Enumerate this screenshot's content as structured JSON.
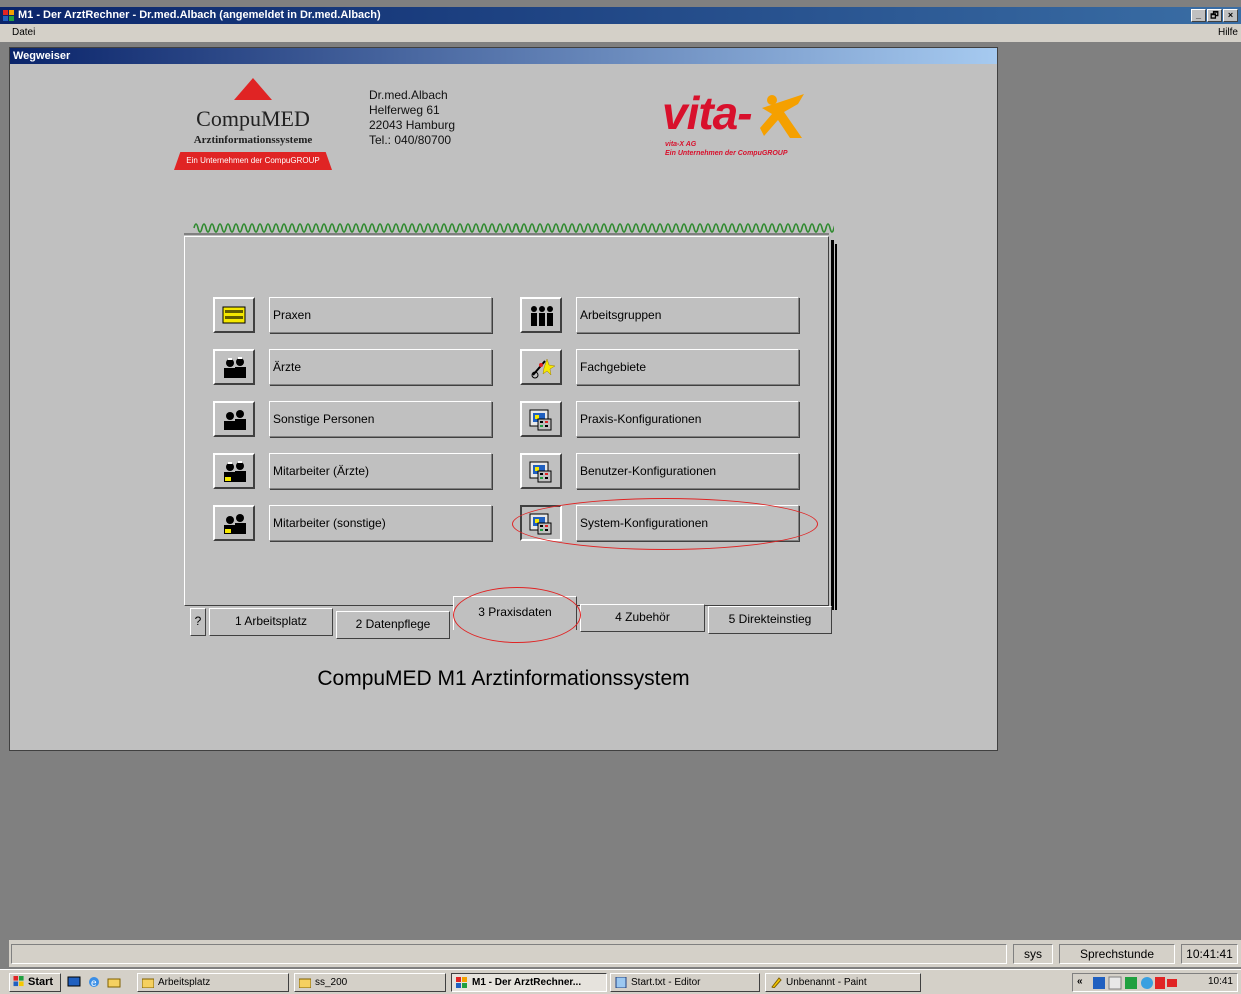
{
  "app": {
    "title": "M1 - Der ArztRechner  -  Dr.med.Albach (angemeldet in Dr.med.Albach)",
    "window_buttons": [
      "_",
      "🗗",
      "×"
    ],
    "menu_left": "Datei",
    "menu_right": "Hilfe"
  },
  "child_window": {
    "title": "Wegweiser"
  },
  "logo_compumed": {
    "name": "CompuMED",
    "subtitle": "Arztinformationssysteme",
    "band": "Ein Unternehmen der CompuGROUP"
  },
  "address": [
    "Dr.med.Albach",
    "Helferweg 61",
    "22043 Hamburg",
    "Tel.: 040/80700"
  ],
  "logo_vita": {
    "word": "vita-",
    "ag": "vita-X AG",
    "sub": "Ein Unternehmen der CompuGROUP"
  },
  "left_buttons": [
    {
      "label": "Praxen",
      "icon": "praxis-icon"
    },
    {
      "label": "Ärzte",
      "icon": "doctors-icon"
    },
    {
      "label": "Sonstige Personen",
      "icon": "persons-icon"
    },
    {
      "label": "Mitarbeiter (Ärzte)",
      "icon": "staff-doctors-icon"
    },
    {
      "label": "Mitarbeiter (sonstige)",
      "icon": "staff-other-icon"
    }
  ],
  "right_buttons": [
    {
      "label": "Arbeitsgruppen",
      "icon": "groups-icon"
    },
    {
      "label": "Fachgebiete",
      "icon": "specialties-icon"
    },
    {
      "label": "Praxis-Konfigurationen",
      "icon": "config-icon"
    },
    {
      "label": "Benutzer-Konfigurationen",
      "icon": "config-icon"
    },
    {
      "label": "System-Konfigurationen",
      "icon": "config-icon"
    }
  ],
  "tabs": [
    {
      "label": "?"
    },
    {
      "label": "1 Arbeitsplatz"
    },
    {
      "label": "2 Datenpflege"
    },
    {
      "label": "3 Praxisdaten",
      "active": true
    },
    {
      "label": "4 Zubehör"
    },
    {
      "label": "5 Direkteinstieg"
    }
  ],
  "caption": "CompuMED M1 Arztinformationssystem",
  "statusbar": {
    "user": "sys",
    "mode": "Sprechstunde",
    "time": "10:41:41"
  },
  "taskbar": {
    "start": "Start",
    "items": [
      {
        "label": "Arbeitsplatz"
      },
      {
        "label": "ss_200"
      },
      {
        "label": "M1 - Der ArztRechner...",
        "active": true
      },
      {
        "label": "Start.txt - Editor"
      },
      {
        "label": "Unbenannt - Paint"
      }
    ],
    "tray_time": "10:41"
  },
  "colors": {
    "brand_red": "#e02424",
    "vita_red": "#d8102c",
    "vita_orange": "#f5a000",
    "titlebar": "#0a246a",
    "highlight_ellipse": "#e02424"
  }
}
